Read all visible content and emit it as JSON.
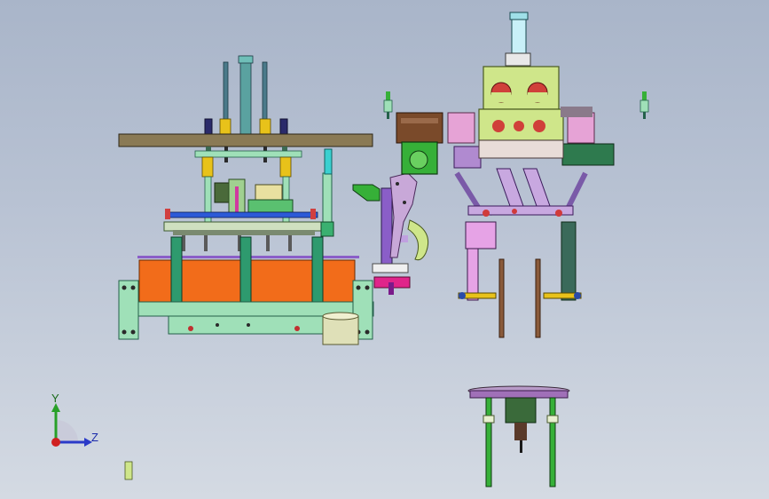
{
  "window": {
    "title": ""
  },
  "triad": {
    "y_label": "Y",
    "z_label": "Z"
  },
  "colors": {
    "background_top": "#a9b5c9",
    "background_bottom": "#d4dae3",
    "plate_brown": "#8a7a55",
    "orange_panel": "#f26c1a",
    "teal_green": "#2e9a6e",
    "mint": "#9fe0b8",
    "lime": "#cfe68a",
    "pink": "#e6a3d6",
    "purple": "#8a5ec8",
    "yellow": "#e8c21a",
    "dark_brown": "#7a4a2a",
    "blue_bar": "#2c5ad8",
    "green_motor": "#36b038"
  },
  "icons": [
    "coordinate-triad-icon"
  ]
}
